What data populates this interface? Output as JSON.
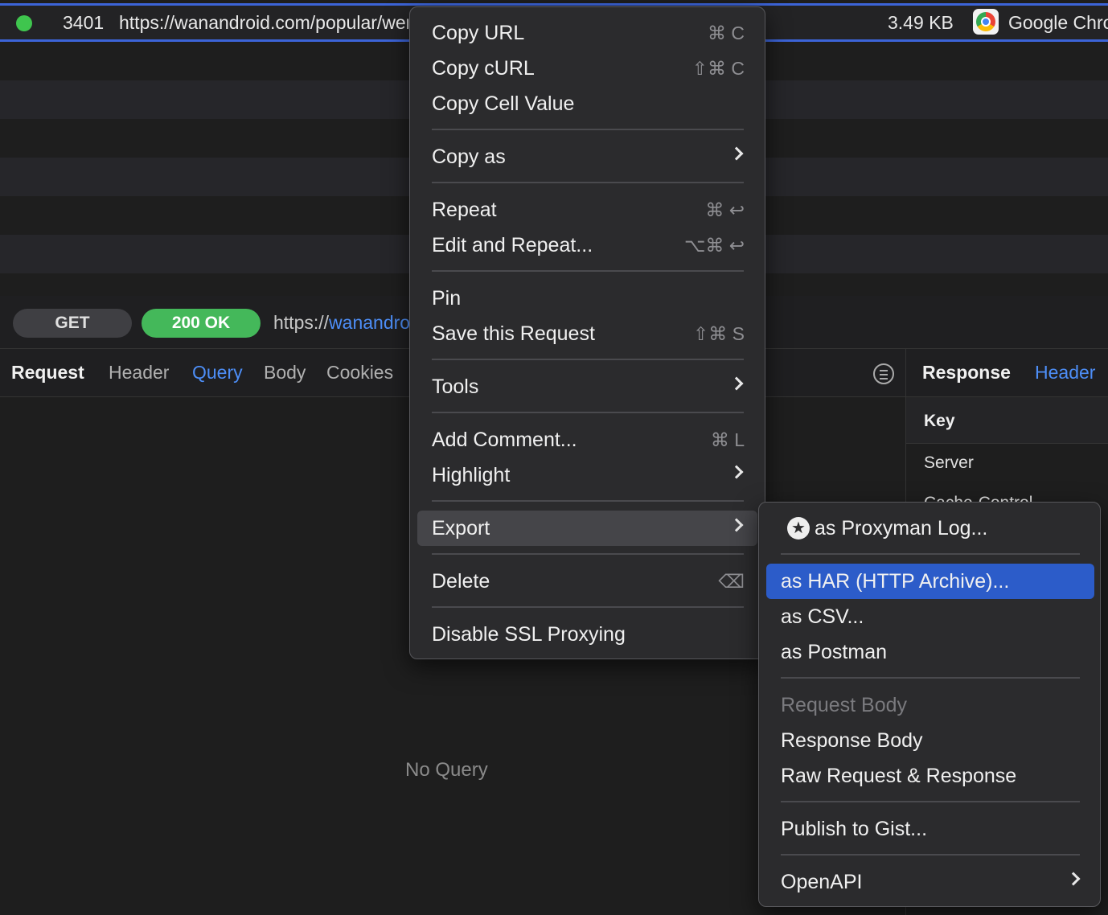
{
  "top_row": {
    "id": "3401",
    "url": "https://wanandroid.com/popular/wenda/json",
    "size": "3.49 KB",
    "client": "Google Chrome",
    "status_color": "#3fc54e"
  },
  "request_line": {
    "method": "GET",
    "status": "200 OK",
    "scheme": "https://",
    "host": "wanandroid.com"
  },
  "request_tabs": {
    "title": "Request",
    "tabs": [
      "Header",
      "Query",
      "Body",
      "Cookies"
    ],
    "active": "Query"
  },
  "empty_state": "No Query",
  "response": {
    "title": "Response",
    "tab": "Header",
    "column_key": "Key",
    "rows": [
      "Server",
      "Cache-Control"
    ]
  },
  "context_menu": {
    "items": [
      {
        "label": "Copy URL",
        "shortcut": "⌘ C"
      },
      {
        "label": "Copy cURL",
        "shortcut": "⇧⌘ C"
      },
      {
        "label": "Copy Cell Value",
        "shortcut": ""
      },
      {
        "label": "Copy as",
        "submenu": true
      },
      {
        "label": "Repeat",
        "shortcut": "⌘ ↩"
      },
      {
        "label": "Edit and Repeat...",
        "shortcut": "⌥⌘ ↩"
      },
      {
        "label": "Pin",
        "shortcut": ""
      },
      {
        "label": "Save this Request",
        "shortcut": "⇧⌘ S"
      },
      {
        "label": "Tools",
        "submenu": true
      },
      {
        "label": "Add Comment...",
        "shortcut": "⌘ L"
      },
      {
        "label": "Highlight",
        "submenu": true
      },
      {
        "label": "Export",
        "submenu": true,
        "highlighted": true
      },
      {
        "label": "Delete",
        "shortcut": "⌫"
      },
      {
        "label": "Disable SSL Proxying",
        "shortcut": ""
      }
    ]
  },
  "export_submenu": {
    "items": [
      {
        "label": "as Proxyman Log...",
        "icon": "proxyman-star-icon"
      },
      {
        "label": "as HAR (HTTP Archive)...",
        "selected": true
      },
      {
        "label": "as CSV..."
      },
      {
        "label": "as Postman"
      },
      {
        "label": "Request Body",
        "disabled": true
      },
      {
        "label": "Response Body"
      },
      {
        "label": "Raw Request & Response"
      },
      {
        "label": "Publish to Gist..."
      },
      {
        "label": "OpenAPI",
        "submenu": true
      }
    ]
  },
  "colors": {
    "accent": "#3c64d8",
    "selection": "#2c5cc9",
    "link": "#4d8ef7",
    "ok_green": "#44b85a"
  }
}
